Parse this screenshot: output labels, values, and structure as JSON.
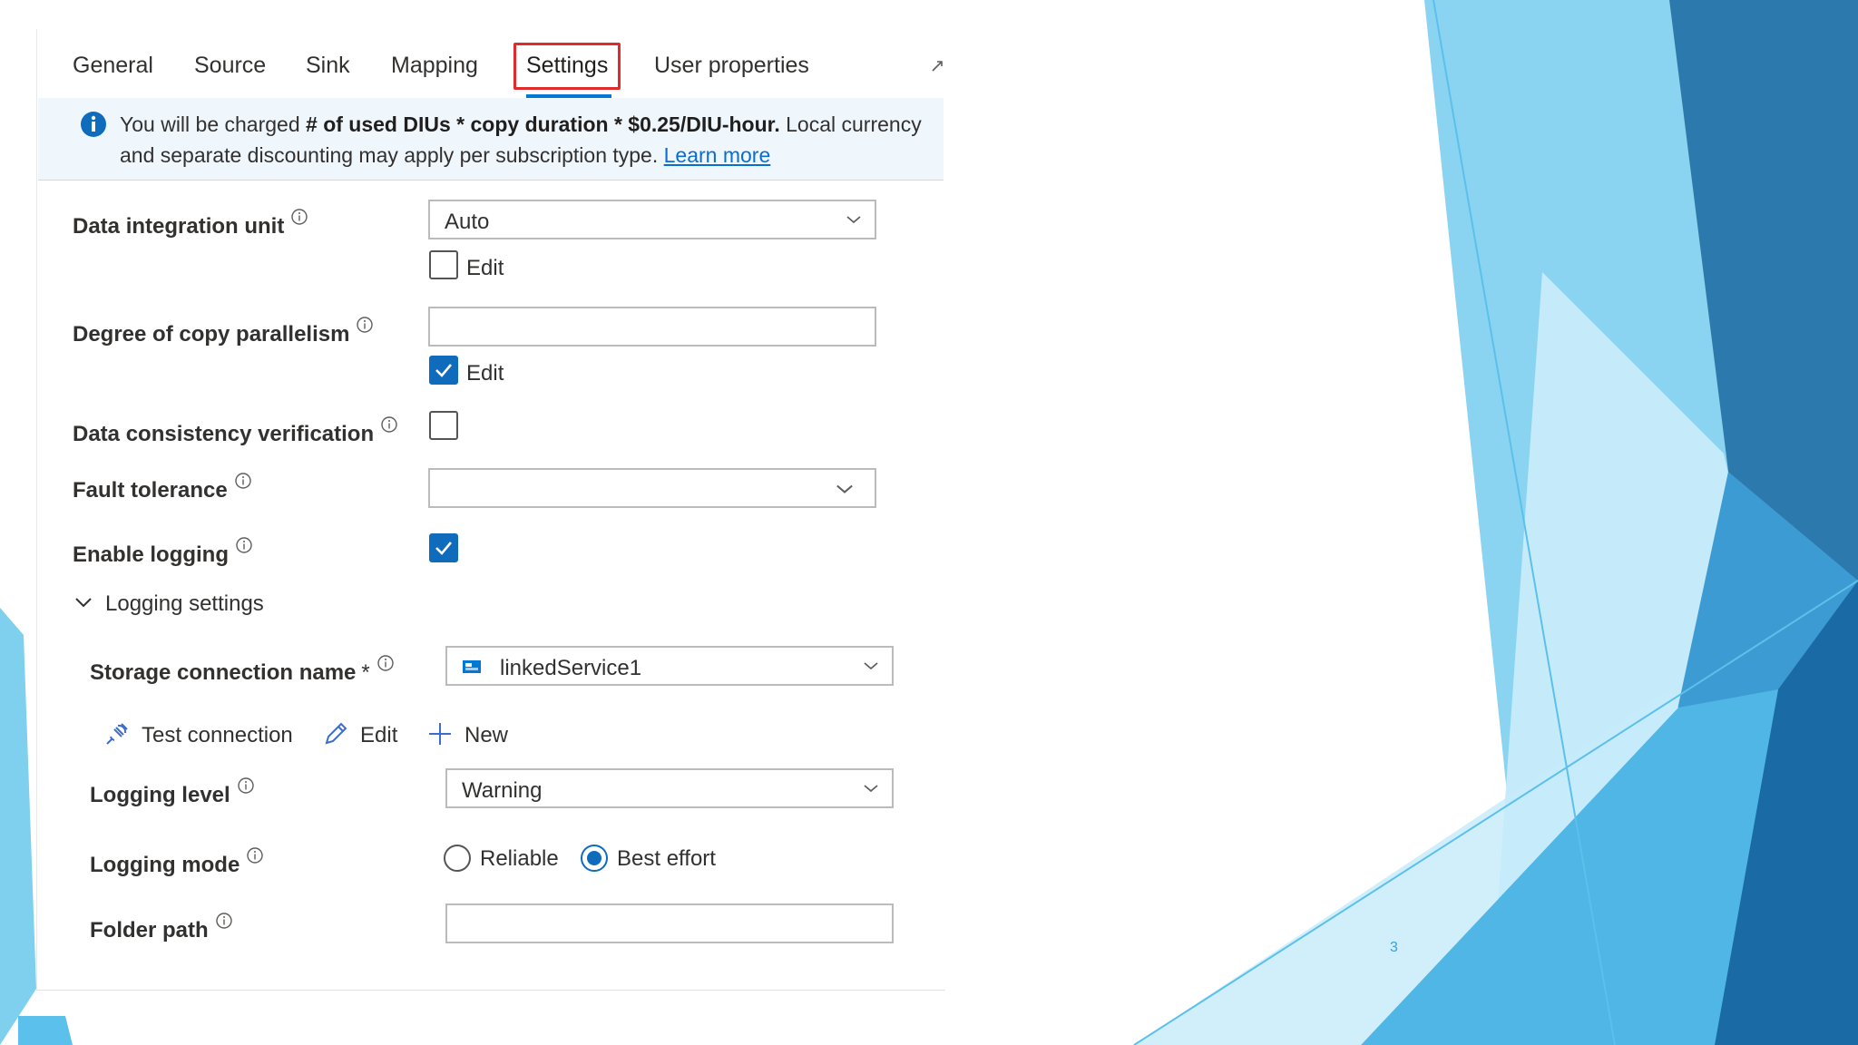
{
  "tabs": [
    {
      "label": "General",
      "active": false
    },
    {
      "label": "Source",
      "active": false
    },
    {
      "label": "Sink",
      "active": false
    },
    {
      "label": "Mapping",
      "active": false
    },
    {
      "label": "Settings",
      "active": true
    },
    {
      "label": "User properties",
      "active": false
    }
  ],
  "banner": {
    "text_before": "You will be charged ",
    "text_bold": "# of used DIUs * copy duration * $0.25/DIU-hour.",
    "text_after": " Local currency and separate discounting may apply per subscription type. ",
    "link": "Learn more"
  },
  "fields": {
    "diu": {
      "label": "Data integration unit",
      "value": "Auto",
      "edit_label": "Edit",
      "edit_checked": false
    },
    "parallelism": {
      "label": "Degree of copy parallelism",
      "value": "",
      "edit_label": "Edit",
      "edit_checked": true
    },
    "consistency": {
      "label": "Data consistency verification",
      "checked": false
    },
    "fault_tolerance": {
      "label": "Fault tolerance",
      "value": ""
    },
    "logging": {
      "label": "Enable logging",
      "checked": true
    }
  },
  "logging_settings": {
    "title": "Logging settings",
    "expanded": true,
    "storage": {
      "label": "Storage connection name",
      "required_mark": "*",
      "value": "linkedService1"
    },
    "actions": {
      "test": "Test connection",
      "edit": "Edit",
      "new": "New"
    },
    "level": {
      "label": "Logging level",
      "value": "Warning"
    },
    "mode": {
      "label": "Logging mode",
      "options": [
        "Reliable",
        "Best effort"
      ],
      "selected": "Best effort"
    },
    "folder": {
      "label": "Folder path",
      "value": ""
    }
  },
  "slide_number": "3",
  "colors": {
    "accent": "#0f6cbd",
    "highlight_box": "#e02b2b",
    "link": "#0a6ed1",
    "banner_bg": "#eff6fc"
  }
}
